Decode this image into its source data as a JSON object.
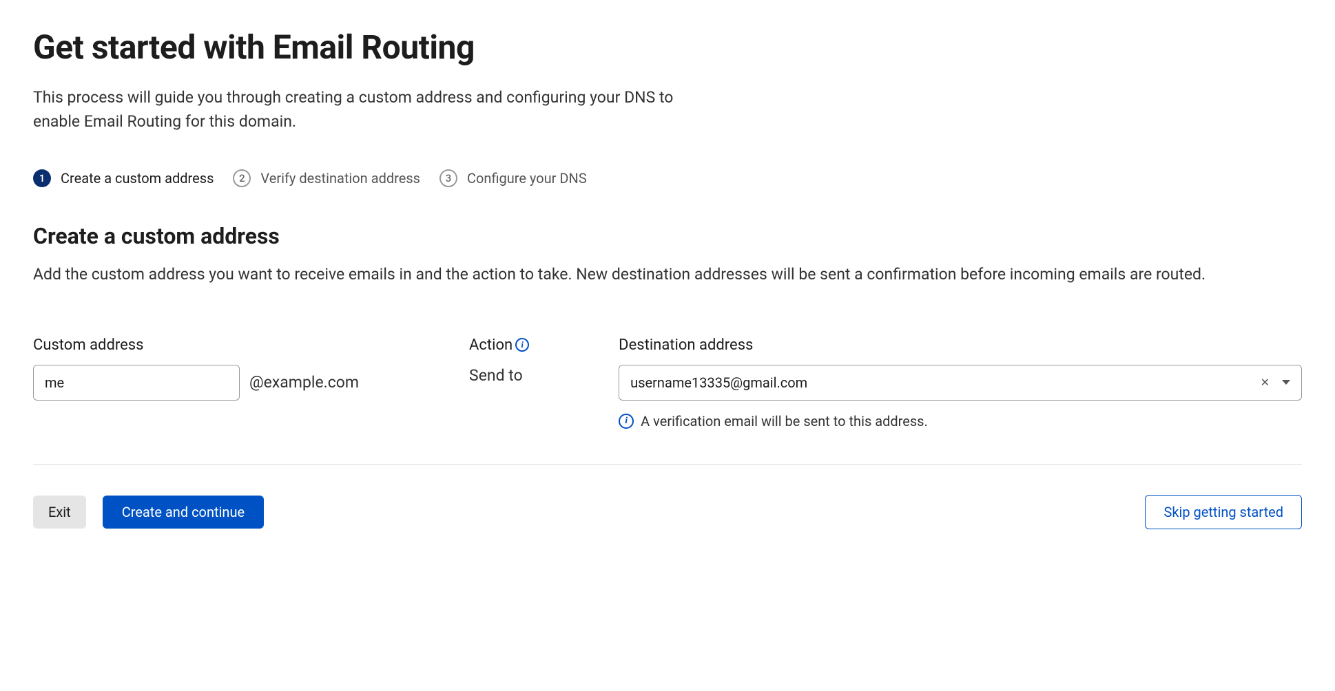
{
  "page": {
    "title": "Get started with Email Routing",
    "subtitle": "This process will guide you through creating a custom address and configuring your DNS to enable Email Routing for this domain."
  },
  "steps": [
    {
      "num": "1",
      "label": "Create a custom address",
      "active": true
    },
    {
      "num": "2",
      "label": "Verify destination address",
      "active": false
    },
    {
      "num": "3",
      "label": "Configure your DNS",
      "active": false
    }
  ],
  "section": {
    "title": "Create a custom address",
    "desc": "Add the custom address you want to receive emails in and the action to take. New destination addresses will be sent a confirmation before incoming emails are routed."
  },
  "form": {
    "custom_address_label": "Custom address",
    "custom_address_value": "me",
    "domain_suffix": "@example.com",
    "action_label": "Action",
    "action_value": "Send to",
    "destination_label": "Destination address",
    "destination_value": "username13335@gmail.com",
    "destination_info": "A verification email will be sent to this address."
  },
  "footer": {
    "exit_label": "Exit",
    "continue_label": "Create and continue",
    "skip_label": "Skip getting started"
  }
}
